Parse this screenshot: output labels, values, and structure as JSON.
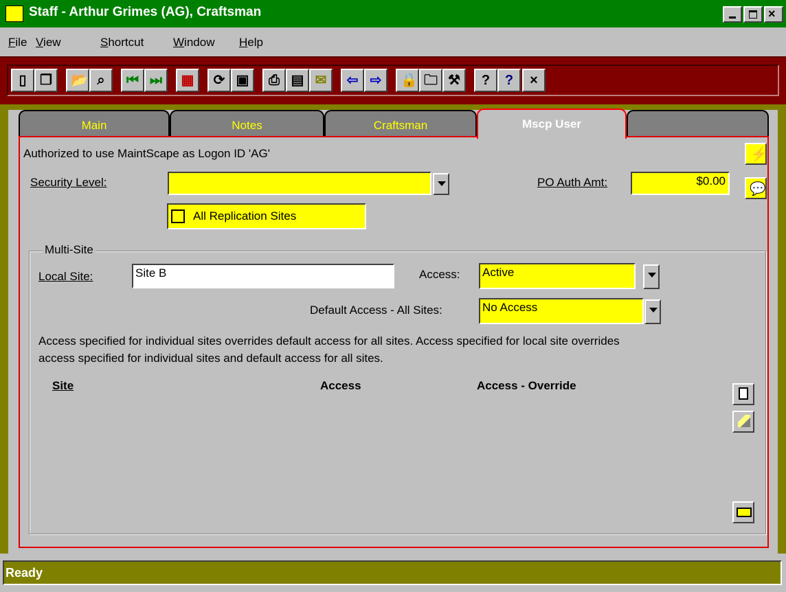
{
  "window": {
    "title": "Staff - Arthur Grimes (AG), Craftsman"
  },
  "menu": [
    {
      "label": "File"
    },
    {
      "label": "View"
    },
    {
      "label": "Shortcut"
    },
    {
      "label": "Window"
    },
    {
      "label": "Help"
    }
  ],
  "toolbar": {
    "icons": [
      "new-doc-icon",
      "copy-doc-icon",
      "open-folder-icon",
      "search-binoculars-icon",
      "first-record-icon",
      "last-record-icon",
      "calculator-icon",
      "refresh-icon",
      "save-icon",
      "print-icon",
      "print-preview-icon",
      "mail-icon",
      "back-arrow-icon",
      "forward-arrow-icon",
      "lock-icon",
      "folder-open-icon",
      "tools-icon",
      "help-icon",
      "context-help-icon",
      "close-icon"
    ]
  },
  "tabs": [
    {
      "label": "Main"
    },
    {
      "label": "Notes"
    },
    {
      "label": "Craftsman"
    },
    {
      "label": "Mscp User"
    }
  ],
  "mscp_user": {
    "authorized_text": "Authorized to use MaintScape as Logon ID 'AG'",
    "security_level_label": "Security Level:",
    "security_level_value": "",
    "po_auth_label": "PO Auth Amt:",
    "po_auth_value": "$0.00",
    "all_replication_label": "All Replication Sites",
    "all_replication_checked": false,
    "multisite": {
      "group_title": "Multi-Site",
      "local_site_label": "Local Site:",
      "local_site_value": "Site B",
      "access_label": "Access:",
      "access_value": "Active",
      "default_access_label": "Default Access - All Sites:",
      "default_access_value": "No Access",
      "info_line1": "Access specified for individual sites overrides default access for all sites.  Access specified for local site overrides",
      "info_line2": "access specified for individual sites and default access for all sites.",
      "columns": [
        "Site",
        "Access",
        "Access - Override"
      ]
    }
  },
  "status": {
    "text": "Ready"
  },
  "colors": {
    "title_bar": "#008000",
    "toolbar_bg": "#800000",
    "workspace": "#808000",
    "field_yellow": "#ffff00",
    "tab_text": "#ffff00",
    "active_border": "#e00000"
  }
}
